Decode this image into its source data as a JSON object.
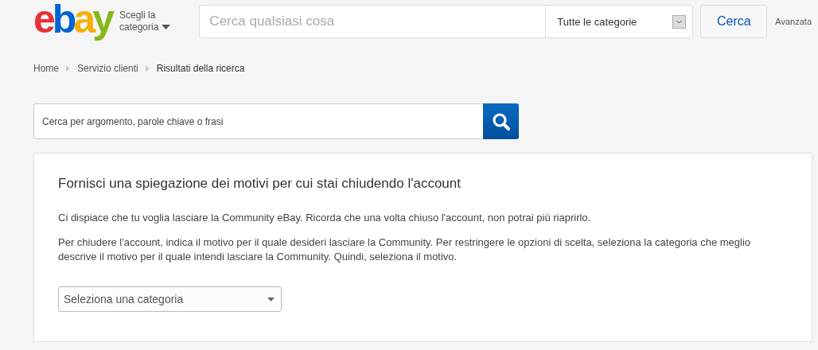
{
  "header": {
    "logo": "ebay",
    "category_chooser": {
      "line_1": "Scegli la",
      "line_2": "categoria"
    },
    "search": {
      "placeholder": "Cerca qualsiasi cosa"
    },
    "category_select": {
      "value": "Tutte le categorie"
    },
    "search_button": "Cerca",
    "advanced_link": "Avanzata"
  },
  "breadcrumb": [
    {
      "label": "Home"
    },
    {
      "label": "Servizio clienti"
    },
    {
      "label": "Risultati della ricerca"
    }
  ],
  "help_search": {
    "placeholder": "Cerca per argomento, parole chiave o frasi"
  },
  "card": {
    "title": "Fornisci una spiegazione dei motivi per cui stai chiudendo l'account",
    "paragraphs": [
      "Ci dispiace che tu voglia lasciare la Community eBay. Ricorda che una volta chiuso l'account, non potrai più riaprirlo.",
      "Per chiudere l'account, indica il motivo per il quale desideri lasciare la Community. Per restringere le opzioni di scelta, seleziona la categoria che meglio descrive il motivo per il quale intendi lasciare la Community. Quindi, seleziona il motivo."
    ],
    "category_select": {
      "value": "Seleziona una categoria"
    }
  }
}
